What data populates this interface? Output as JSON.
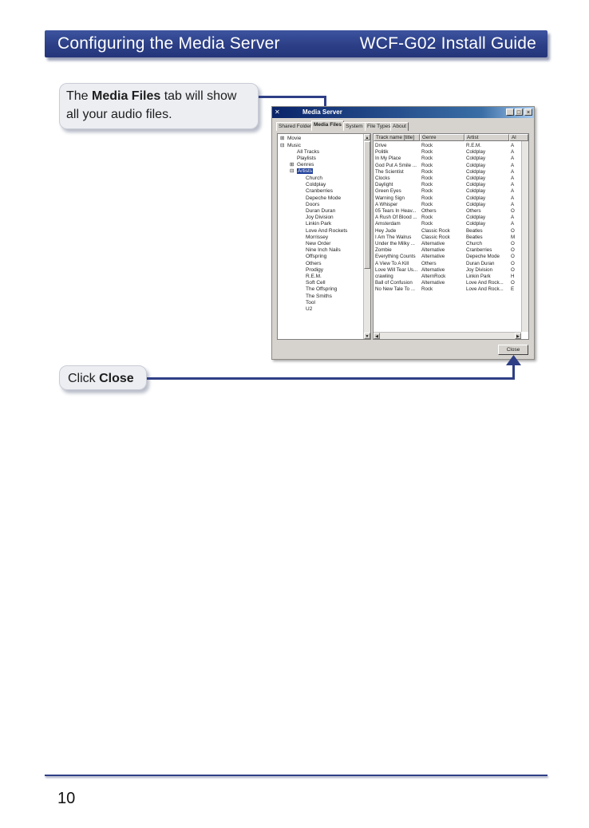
{
  "header": {
    "left_title": "Configuring the Media Server",
    "right_title": "WCF-G02 Install Guide"
  },
  "callouts": {
    "media_files": {
      "pre": "The ",
      "bold": "Media Files",
      "post1": " tab will show",
      "line2": "all your audio files."
    },
    "close": {
      "pre": "Click ",
      "bold": "Close"
    }
  },
  "window": {
    "title": "Media Server",
    "controls": {
      "minimize": "_",
      "maximize": "□",
      "close": "×"
    },
    "tabs": [
      "Shared Folder",
      "Media Files",
      "System",
      "File Types",
      "About"
    ],
    "active_tab": "Media Files",
    "tree": {
      "movie": "Movie",
      "music": "Music",
      "all_tracks": "All Tracks",
      "playlists": "Playlists",
      "genres": "Genres",
      "artists": "Artists",
      "artist_items": [
        "Church",
        "Coldplay",
        "Cranberries",
        "Depeche Mode",
        "Doors",
        "Duran Duran",
        "Joy Division",
        "Linkin Park",
        "Love And Rockets",
        "Morrissey",
        "New Order",
        "Nine Inch Nails",
        "Offspring",
        "Others",
        "Prodigy",
        "R.E.M.",
        "Soft Cell",
        "The Offspring",
        "The Smiths",
        "Tool",
        "U2"
      ]
    },
    "columns": [
      "Track name [title]",
      "Genre",
      "Artist",
      "Al"
    ],
    "rows": [
      [
        "Drive",
        "Rock",
        "R.E.M.",
        "A"
      ],
      [
        "Politik",
        "Rock",
        "Coldplay",
        "A"
      ],
      [
        "In My Place",
        "Rock",
        "Coldplay",
        "A"
      ],
      [
        "God Put A Smile ...",
        "Rock",
        "Coldplay",
        "A"
      ],
      [
        "The Scientist",
        "Rock",
        "Coldplay",
        "A"
      ],
      [
        "Clocks",
        "Rock",
        "Coldplay",
        "A"
      ],
      [
        "Daylight",
        "Rock",
        "Coldplay",
        "A"
      ],
      [
        "Green Eyes",
        "Rock",
        "Coldplay",
        "A"
      ],
      [
        "Warning Sign",
        "Rock",
        "Coldplay",
        "A"
      ],
      [
        "A Whisper",
        "Rock",
        "Coldplay",
        "A"
      ],
      [
        "05 Tears In Heav...",
        "Others",
        "Others",
        "O"
      ],
      [
        "A Rush Of Blood ...",
        "Rock",
        "Coldplay",
        "A"
      ],
      [
        "Amsterdam",
        "Rock",
        "Coldplay",
        "A"
      ],
      [
        "Hey Jude",
        "Classic Rock",
        "Beatles",
        "O"
      ],
      [
        "I Am The Walrus",
        "Classic Rock",
        "Beatles",
        "M"
      ],
      [
        "Under the Milky ...",
        "Alternative",
        "Church",
        "O"
      ],
      [
        "Zombie",
        "Alternative",
        "Cranberries",
        "O"
      ],
      [
        "Everything Counts",
        "Alternative",
        "Depeche Mode",
        "O"
      ],
      [
        "A View To A Kill",
        "Others",
        "Duran Duran",
        "O"
      ],
      [
        "Love Will Tear Us...",
        "Alternative",
        "Joy Division",
        "O"
      ],
      [
        "crawling",
        "AlternRock",
        "Linkin Park",
        "H"
      ],
      [
        "Ball of Confusion",
        "Alternative",
        "Love And Rock...",
        "O"
      ],
      [
        "No New Tale To ...",
        "Rock",
        "Love And Rock...",
        "E"
      ]
    ],
    "close_button": "Close"
  },
  "page_number": "10",
  "colors": {
    "banner": "#2c3f86",
    "callout_bg": "#eceef2",
    "titlebar": "#0a246a"
  }
}
